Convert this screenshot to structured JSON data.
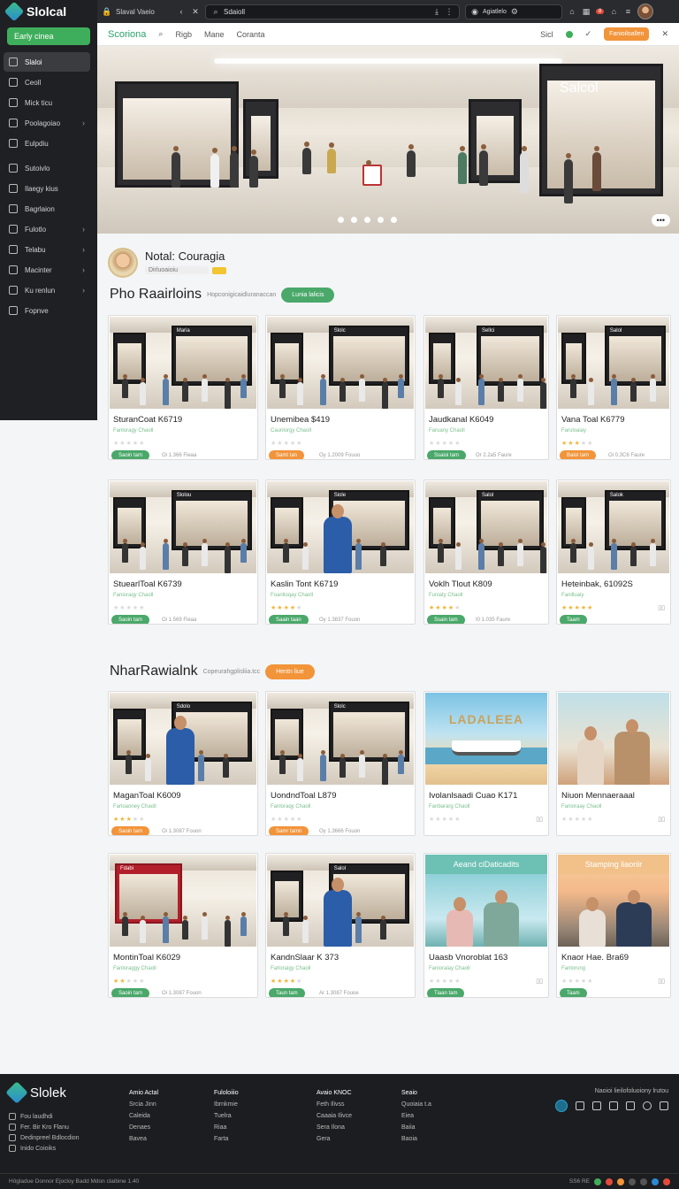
{
  "app": {
    "logo_text": "Slolcal",
    "cta_label": "Early cinea"
  },
  "sidebar": {
    "items": [
      {
        "label": "Slaloi",
        "icon": "pencil-icon",
        "active": true,
        "chevron": false
      },
      {
        "label": "Ceoll",
        "icon": "list-icon",
        "active": false,
        "chevron": false
      },
      {
        "label": "Mick ticu",
        "icon": "pencil-icon",
        "active": false,
        "chevron": false
      },
      {
        "label": "Poolagoiao",
        "icon": "tag-icon",
        "active": false,
        "chevron": true
      },
      {
        "label": "Eulpdiu",
        "icon": "pencil-icon",
        "active": false,
        "chevron": false
      },
      {
        "label": "Sutoivlo",
        "icon": "search-icon",
        "active": false,
        "chevron": false
      },
      {
        "label": "Ilaegy kius",
        "icon": "wrench-icon",
        "active": false,
        "chevron": false
      },
      {
        "label": "Bagrlaion",
        "icon": "clipboard-icon",
        "active": false,
        "chevron": false
      },
      {
        "label": "Fulotlo",
        "icon": "gallery-icon",
        "active": false,
        "chevron": true
      },
      {
        "label": "Telabu",
        "icon": "document-icon",
        "active": false,
        "chevron": true
      },
      {
        "label": "Macinter",
        "icon": "calendar-icon",
        "active": false,
        "chevron": true
      },
      {
        "label": "Ku renlun",
        "icon": "settings-icon",
        "active": false,
        "chevron": true
      },
      {
        "label": "Fopnve",
        "icon": "undo-icon",
        "active": false,
        "chevron": false
      }
    ]
  },
  "browser": {
    "tab_title": "Slaval Vaeio",
    "url": "Sdaioll",
    "account_label": "Agiatlelo"
  },
  "nav": {
    "brand": "Scoriona",
    "links": [
      "Rigb",
      "Mane",
      "Coranta"
    ],
    "right_text": "Sicl",
    "cta": "Fanioiloallen"
  },
  "hero": {
    "store_sign": "Salcol",
    "slide_count": 5,
    "active_slide": 0,
    "more_label": "•••"
  },
  "profile": {
    "name": "Notal: Couragia",
    "meta": "Dirluoaioiu"
  },
  "section1": {
    "title": "Pho Raairloins",
    "subtitle": "Hopconigicaidluranaccan",
    "button": "Lunia lalicis"
  },
  "section2": {
    "title": "NharRawialnk",
    "subtitle": "Copeurahgplisliia.tcc",
    "button": "Hentn liue"
  },
  "cards1": [
    {
      "title": "SturanCoat K6719",
      "sub": "Fanloragy Chaoll",
      "stars": 0,
      "button": "Saoin tam",
      "meta": "Oi 1.366 Fieaa",
      "image": "mall",
      "sign": "Maria"
    },
    {
      "title": "Unemibea $419",
      "sub": "Caunlorgy Chaoll",
      "stars": 0,
      "button": "Samt tan",
      "meta": "Oy 1.2009 Fouuo",
      "image": "mall",
      "sign": "Slolc"
    },
    {
      "title": "Jaudkanal K6049",
      "sub": "Faruany Chaoll",
      "stars": 0,
      "button": "Ssaioi tam",
      "meta": "Or 2.2a5 Faure",
      "image": "mall",
      "sign": "Sellci"
    },
    {
      "title": "Vana Toal K6779",
      "sub": "Faruloaiay",
      "stars": 3,
      "button": "Baioi tam",
      "meta": "Oi 0.3C6 Faure",
      "image": "mall",
      "sign": "Salol"
    },
    {
      "title": "StuearlToal K6739",
      "sub": "Fanioraqy Chaoll",
      "stars": 0,
      "button": "Saoin tam",
      "meta": "Oi 1.569 Fieaa",
      "image": "mall",
      "sign": "Slolou"
    },
    {
      "title": "Kaslin Tont K6719",
      "sub": "Foanlioqay Chaoll",
      "stars": 4,
      "button": "Saain taan",
      "meta": "Oy 1.3837 Fouon",
      "image": "person",
      "sign": "Siole"
    },
    {
      "title": "Voklh Tlout K809",
      "sub": "Funiaty Chaoll",
      "stars": 4,
      "button": "Ssain tam",
      "meta": "I0 1.035 Faure",
      "image": "mall",
      "sign": "Salol"
    },
    {
      "title": "Heteinbak, 61092S",
      "sub": "Fanilluaiy",
      "stars": 5,
      "button": "Taam",
      "meta": "",
      "image": "mall",
      "sign": "Salok"
    }
  ],
  "cards2": [
    {
      "title": "MaganToal K6009",
      "sub": "Farloaoney Chaoll",
      "stars": 3,
      "button": "Saoin tam",
      "meta": "Oi 1.3087 Fouon",
      "image": "person",
      "sign": "Sdolo"
    },
    {
      "title": "UondndToal L879",
      "sub": "Fanloraqy Chaoll",
      "stars": 0,
      "button": "Samr tamn",
      "meta": "Oy 1.3666 Fouon",
      "image": "mall",
      "sign": "Slolc"
    },
    {
      "title": "Ivolanlsaadi Cuao K171",
      "sub": "Fanbararg Chaoll",
      "stars": 0,
      "button": "",
      "meta": "",
      "image": "beach",
      "sign": "LADALEEA"
    },
    {
      "title": "Niuon Mennaeraaal",
      "sub": "Fanioraay Chaoll",
      "stars": 0,
      "button": "",
      "meta": "",
      "image": "couple",
      "sign": ""
    },
    {
      "title": "MontinToal K6029",
      "sub": "Fanloraggy Chaoll",
      "stars": 2,
      "button": "Saoin tam",
      "meta": "Oi 1.3087 Fouon",
      "image": "mall-red",
      "sign": "Fdabi"
    },
    {
      "title": "KandnSlaar K 373",
      "sub": "Farloraigy Chaoll",
      "stars": 4,
      "button": "Taun tam",
      "meta": "Ar 1.3087 Fouoe",
      "image": "person",
      "sign": "Salol"
    },
    {
      "title": "Uaasb Vnoroblat 163",
      "sub": "Fanioraiay Chaoll",
      "stars": 0,
      "button": "Tiaan tam",
      "meta": "",
      "image": "teal",
      "sign": "Aeand ciDaticadits"
    },
    {
      "title": "Knaor Hae. Bra69",
      "sub": "Fanlorung",
      "stars": 0,
      "button": "Taam",
      "meta": "",
      "image": "sunset",
      "sign": "Stamping liaoriir"
    }
  ],
  "footer": {
    "logo": "Slolek",
    "left_links": [
      "Fou laudhdi",
      "Fer. Bir Kro Flanu",
      "Dedinpreel Bdlocdion",
      "Inido Coioiks"
    ],
    "columns": [
      {
        "heading": "Amio Actal",
        "items": [
          "Srcia Jinn",
          "Caleida",
          "Denaes",
          "Bavea"
        ]
      },
      {
        "heading": "Fuloloiiio",
        "items": [
          "Ibrnkmie",
          "Tuelra",
          "Riaa",
          "Farta"
        ]
      },
      {
        "heading": "Avaio KNOC",
        "items": [
          "Feth Ilivss",
          "Caaaia Ilivce",
          "Sera Ilona",
          "Gera"
        ]
      },
      {
        "heading": "Seaio",
        "items": [
          "Quoiaia t.a",
          "Eiea",
          "Baiia",
          "Baoia"
        ]
      }
    ],
    "right_title": "Naoioi lieilofoluoiony lrutou",
    "copyright": "Högladue Donnor Ejocloy Badd Mdon claibine 1.40",
    "status": "SS6 RE"
  }
}
